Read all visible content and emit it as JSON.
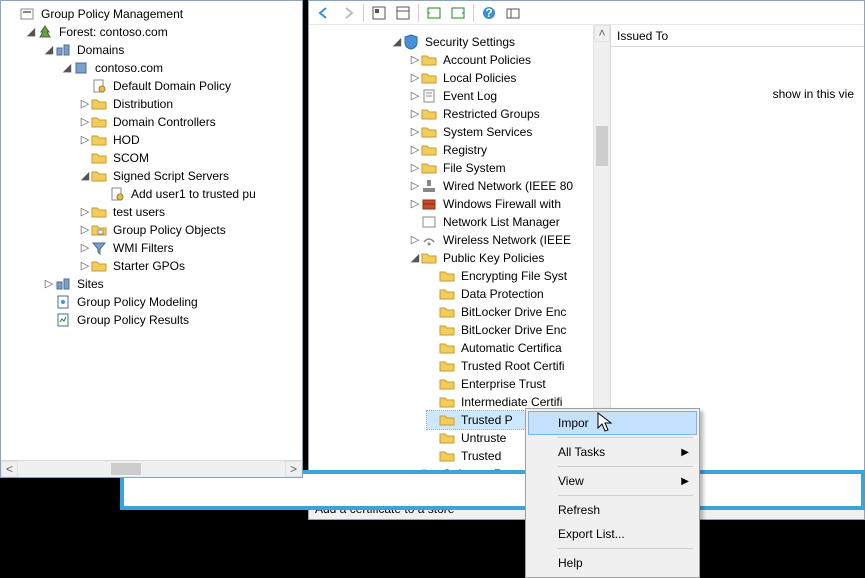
{
  "left": {
    "root": "Group Policy Management",
    "forest": "Forest: contoso.com",
    "domains": "Domains",
    "domain": "contoso.com",
    "ddp": "Default Domain Policy",
    "dist": "Distribution",
    "dc": "Domain Controllers",
    "hod": "HOD",
    "scom": "SCOM",
    "sss": "Signed Script Servers",
    "adduser": "Add user1 to trusted pu",
    "testusers": "test users",
    "gpo": "Group Policy Objects",
    "wmi": "WMI Filters",
    "starter": "Starter GPOs",
    "sites": "Sites",
    "modeling": "Group Policy Modeling",
    "results": "Group Policy Results"
  },
  "mid": {
    "secset": "Security Settings",
    "account": "Account Policies",
    "local": "Local Policies",
    "eventlog": "Event Log",
    "restricted": "Restricted Groups",
    "sysserv": "System Services",
    "registry": "Registry",
    "filesys": "File System",
    "wired": "Wired Network (IEEE 80",
    "firewall": "Windows Firewall with",
    "netlist": "Network List Manager",
    "wireless": "Wireless Network (IEEE",
    "pubkey": "Public Key Policies",
    "efs": "Encrypting File Syst",
    "dataprot": "Data Protection",
    "bitlocker1": "BitLocker Drive Enc",
    "bitlocker2": "BitLocker Drive Enc",
    "autocert": "Automatic Certifica",
    "trustedroot": "Trusted Root Certifi",
    "enttrust": "Enterprise Trust",
    "intermediate": "Intermediate Certifi",
    "trustedpub": "Trusted P",
    "untrusted": "Untruste",
    "trusted2": "Trusted",
    "software": "Software R"
  },
  "res": {
    "header": "Issued To",
    "msg": "show in this vie"
  },
  "status": "Add a certificate to a store",
  "ctx": {
    "import": "Impor",
    "alltasks": "All Tasks",
    "view": "View",
    "refresh": "Refresh",
    "export": "Export List...",
    "help": "Help"
  }
}
